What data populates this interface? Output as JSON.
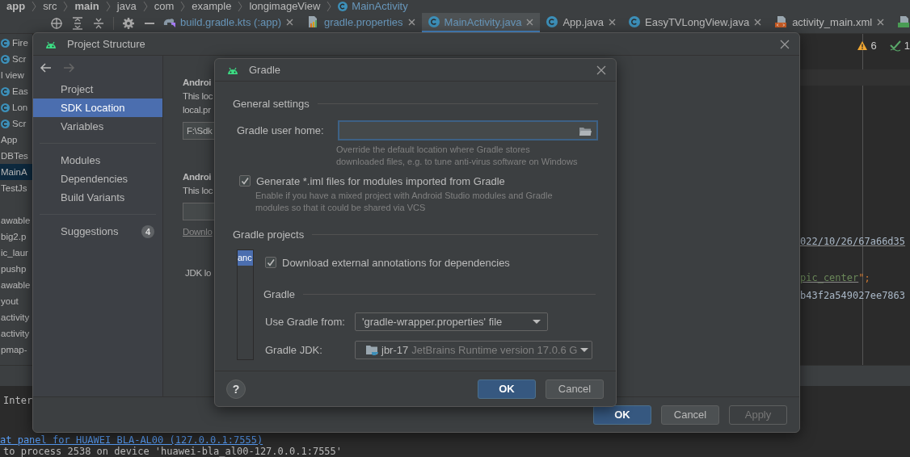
{
  "breadcrumb": [
    {
      "label": "app",
      "kind": "folder",
      "bold": true
    },
    {
      "label": "src",
      "kind": "folder",
      "bold": false
    },
    {
      "label": "main",
      "kind": "folder",
      "bold": true
    },
    {
      "label": "java",
      "kind": "folder",
      "bold": false
    },
    {
      "label": "com",
      "kind": "folder",
      "bold": false
    },
    {
      "label": "example",
      "kind": "folder",
      "bold": false
    },
    {
      "label": "longimageView",
      "kind": "folder",
      "bold": false
    },
    {
      "label": "MainActivity",
      "kind": "class",
      "bold": false
    }
  ],
  "editor_tabs": [
    {
      "label": "build.gradle.kts (:app)",
      "kind": "gradle",
      "modified": true,
      "selected": false
    },
    {
      "label": "gradle.properties",
      "kind": "properties",
      "modified": true,
      "selected": false
    },
    {
      "label": "MainActivity.java",
      "kind": "class",
      "modified": true,
      "selected": true
    },
    {
      "label": "App.java",
      "kind": "class",
      "modified": false,
      "selected": false
    },
    {
      "label": "EasyTVLongView.java",
      "kind": "class",
      "modified": false,
      "selected": false
    },
    {
      "label": "activity_main.xml",
      "kind": "xml",
      "modified": false,
      "selected": false
    },
    {
      "kind": "manifest",
      "selected": false
    }
  ],
  "project_tree": [
    {
      "label": "Fire",
      "kind": "class",
      "selected": false
    },
    {
      "label": "Scr",
      "kind": "class",
      "selected": false
    },
    {
      "label": "l view",
      "kind": "plain",
      "selected": false
    },
    {
      "label": "Eas",
      "kind": "class",
      "selected": false
    },
    {
      "label": "Lon",
      "kind": "class",
      "selected": false
    },
    {
      "label": "Scr",
      "kind": "class",
      "selected": false
    },
    {
      "label": "App",
      "kind": "plain",
      "selected": false
    },
    {
      "label": "DBTes",
      "kind": "plain",
      "selected": false
    },
    {
      "label": "MainA",
      "kind": "plain",
      "selected": true
    },
    {
      "label": "TestJs",
      "kind": "plain",
      "selected": false
    },
    {
      "label": "awable",
      "kind": "plain",
      "selected": false
    },
    {
      "label": "big2.p",
      "kind": "plain",
      "selected": false
    },
    {
      "label": "ic_laur",
      "kind": "plain",
      "selected": false
    },
    {
      "label": "pushp",
      "kind": "plain",
      "selected": false
    },
    {
      "label": "awable",
      "kind": "plain",
      "selected": false
    },
    {
      "label": "yout",
      "kind": "plain",
      "selected": false
    },
    {
      "label": "activity",
      "kind": "plain",
      "selected": false
    },
    {
      "label": "activity",
      "kind": "plain",
      "selected": false
    },
    {
      "label": "pmap-",
      "kind": "plain",
      "selected": false
    }
  ],
  "editor": {
    "warnings": "6",
    "checks": "1",
    "code_lines": [
      [
        {
          "text": "022/10/26/67a66d35",
          "kind": "link"
        }
      ],
      [
        {
          "text": "pic_center",
          "kind": "string"
        },
        {
          "text": "\";",
          "kind": "punct"
        }
      ],
      [
        {
          "text": "b43f2a549027ee7863",
          "kind": "plain"
        }
      ]
    ]
  },
  "console": {
    "lines": [
      {
        "text": "Inter",
        "kind": "plain"
      },
      {
        "text": "at panel for HUAWEI BLA-AL00 (127.0.0.1:7555)",
        "kind": "link"
      },
      {
        "text": "to process 2538 on device 'huawei-bla_al00-127.0.0.1:7555'",
        "kind": "plain"
      }
    ]
  },
  "project_structure": {
    "title": "Project Structure",
    "nav_groups": [
      [
        {
          "label": "Project",
          "selected": false
        },
        {
          "label": "SDK Location",
          "selected": true
        },
        {
          "label": "Variables",
          "selected": false
        }
      ],
      [
        {
          "label": "Modules",
          "selected": false
        },
        {
          "label": "Dependencies",
          "selected": false
        },
        {
          "label": "Build Variants",
          "selected": false
        }
      ],
      [
        {
          "label": "Suggestions",
          "selected": false,
          "badge": "4"
        }
      ]
    ],
    "content": [
      {
        "kind": "heading",
        "text": "Androi"
      },
      {
        "kind": "text",
        "text": "This loc"
      },
      {
        "kind": "text",
        "text": "local.pr"
      },
      {
        "kind": "field",
        "text": "F:\\Sdk"
      },
      {
        "kind": "heading",
        "text": "Androi"
      },
      {
        "kind": "text",
        "text": "This loc"
      },
      {
        "kind": "field"
      },
      {
        "kind": "link",
        "text": "Downlo"
      },
      {
        "kind": "label",
        "text": "JDK lo"
      }
    ],
    "buttons": [
      {
        "label": "OK",
        "kind": "primary",
        "disabled": false
      },
      {
        "label": "Cancel",
        "kind": "normal",
        "disabled": false
      },
      {
        "label": "Apply",
        "kind": "normal",
        "disabled": true
      }
    ]
  },
  "gradle_dialog": {
    "title": "Gradle",
    "general_settings": {
      "heading": "General settings",
      "user_home": {
        "label": "Gradle user home:",
        "focused": true
      },
      "user_home_hint": [
        "Override the default location where Gradle stores",
        "downloaded files, e.g. to tune anti-virus software on Windows"
      ],
      "generate_iml": {
        "label": "Generate *.iml files for modules imported from Gradle",
        "checked": true
      },
      "generate_iml_hint": [
        "Enable if you have a mixed project with Android Studio modules and Gradle",
        "modules so that it could be shared via VCS"
      ]
    },
    "gradle_projects": {
      "heading": "Gradle projects",
      "projects": [
        {
          "label": "anc",
          "selected": true
        }
      ],
      "download_annotations": {
        "label": "Download external annotations for dependencies",
        "checked": true
      },
      "gradle_heading": "Gradle",
      "use_gradle_from": {
        "label": "Use Gradle from:",
        "value": "'gradle-wrapper.properties' file"
      },
      "gradle_jdk": {
        "label": "Gradle JDK:",
        "value": "jbr-17",
        "detail": "JetBrains Runtime version 17.0.6 G"
      }
    },
    "help": "?",
    "buttons": [
      {
        "label": "OK",
        "kind": "primary"
      },
      {
        "label": "Cancel",
        "kind": "normal"
      }
    ]
  }
}
